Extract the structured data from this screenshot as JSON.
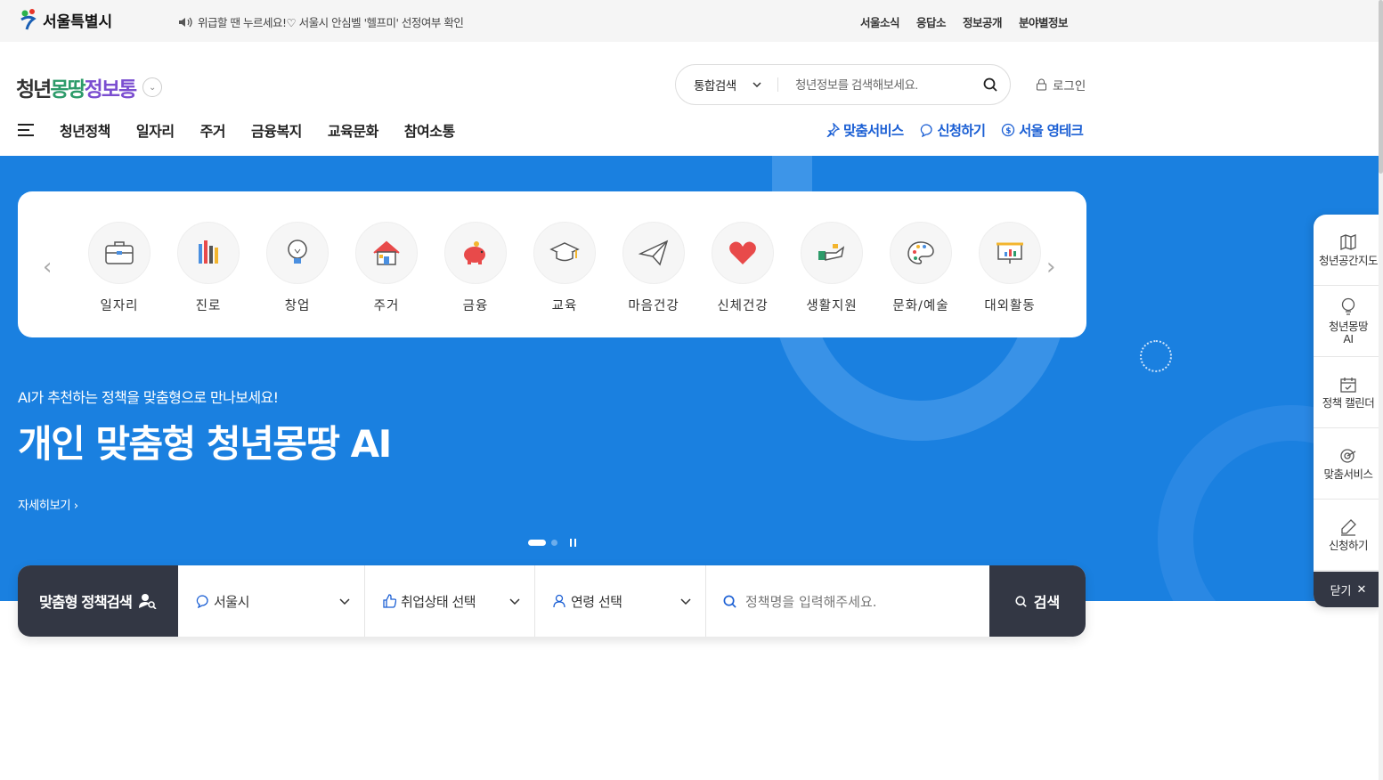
{
  "topbar": {
    "seoul_logo": "서울특별시",
    "notice": "위급할 땐 누르세요!♡ 서울시 안심벨 '헬프미' 선정여부 확인",
    "links": [
      "서울소식",
      "응답소",
      "정보공개",
      "분야별정보"
    ]
  },
  "header": {
    "logo": {
      "part1": "청년",
      "part2": "몽땅",
      "part3": "정보통"
    },
    "search": {
      "scope": "통합검색",
      "placeholder": "청년정보를 검색해보세요."
    },
    "login": "로그인",
    "gnb": [
      "청년정책",
      "일자리",
      "주거",
      "금융복지",
      "교육문화",
      "참여소통"
    ],
    "quick_links": [
      {
        "label": "맞춤서비스",
        "icon": "pin-icon"
      },
      {
        "label": "신청하기",
        "icon": "chat-icon"
      },
      {
        "label": "서울 영테크",
        "icon": "coin-icon"
      }
    ]
  },
  "categories": [
    {
      "label": "일자리",
      "icon": "briefcase-icon"
    },
    {
      "label": "진로",
      "icon": "pencils-icon"
    },
    {
      "label": "창업",
      "icon": "lightbulb-icon"
    },
    {
      "label": "주거",
      "icon": "house-icon"
    },
    {
      "label": "금융",
      "icon": "piggybank-icon"
    },
    {
      "label": "교육",
      "icon": "graduation-cap-icon"
    },
    {
      "label": "마음건강",
      "icon": "paper-plane-icon"
    },
    {
      "label": "신체건강",
      "icon": "heart-icon"
    },
    {
      "label": "생활지원",
      "icon": "hand-icon"
    },
    {
      "label": "문화/예술",
      "icon": "palette-icon"
    },
    {
      "label": "대외활동",
      "icon": "presentation-board-icon"
    }
  ],
  "hero": {
    "subtitle": "AI가 추천하는 정책을 맞춤형으로 만나보세요!",
    "title": "개인 맞춤형 청년몽땅 AI",
    "more": "자세히보기 ›"
  },
  "finder": {
    "title": "맞춤형 정책검색",
    "region": "서울시",
    "employment": "취업상태 선택",
    "age": "연령 선택",
    "query_placeholder": "정책명을 입력해주세요.",
    "button": "검색"
  },
  "side_quick": {
    "items": [
      "청년공간지도",
      "청년몽땅 AI",
      "정책 캘린더",
      "맞춤서비스",
      "신청하기"
    ],
    "close": "닫기"
  },
  "colors": {
    "brand_blue": "#1a80e0",
    "dark": "#333744",
    "link_blue": "#1b5fd4"
  }
}
